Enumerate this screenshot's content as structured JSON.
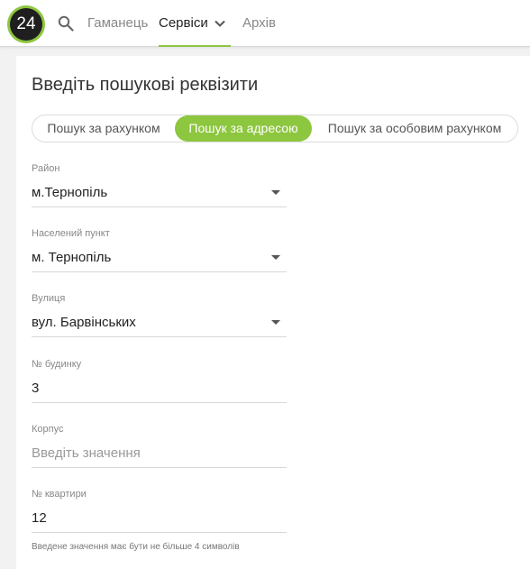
{
  "header": {
    "logo_text": "24",
    "nav": [
      {
        "label": "Гаманець"
      },
      {
        "label": "Сервіси"
      },
      {
        "label": "Архів"
      }
    ]
  },
  "form": {
    "title": "Введіть пошукові реквізити",
    "tabs": [
      {
        "label": "Пошук за рахунком",
        "active": false
      },
      {
        "label": "Пошук за адресою",
        "active": true
      },
      {
        "label": "Пошук за особовим рахунком",
        "active": false
      }
    ],
    "fields": {
      "district": {
        "label": "Район",
        "value": "м.Тернопіль"
      },
      "locality": {
        "label": "Населений пункт",
        "value": "м. Тернопіль"
      },
      "street": {
        "label": "Вулиця",
        "value": "вул. Барвінських"
      },
      "house": {
        "label": "№ будинку",
        "value": "3"
      },
      "building": {
        "label": "Корпус",
        "value": "",
        "placeholder": "Введіть значення"
      },
      "apartment": {
        "label": "№ квартири",
        "value": "12"
      }
    },
    "hint": "Введене значення має бути не більше 4 символів"
  },
  "colors": {
    "accent": "#8dc63f",
    "logo_bg": "#1f1f1f"
  },
  "icons": {
    "search": "search-icon",
    "chevron": "chevron-down-icon",
    "dropdown": "caret-down-icon"
  }
}
